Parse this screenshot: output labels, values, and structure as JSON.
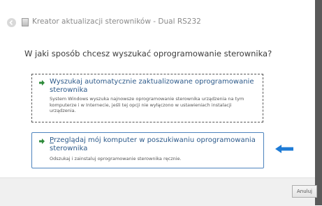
{
  "window": {
    "title": "Kreator aktualizacji sterowników - Dual RS232"
  },
  "dialog": {
    "question": "W jaki sposób chcesz wyszukać oprogramowanie sterownika?",
    "option_auto": {
      "title_line1": "Wyszukaj automatycznie zaktualizowane oprogramowanie",
      "title_line2": "sterownika",
      "description": "System Windows wyszuka najnowsze oprogramowanie sterownika urządzenia na tym komputerze i w Internecie, jeśli tej opcji nie wyłączono w ustawieniach instalacji urządzenia."
    },
    "option_browse": {
      "title_underlined": "P",
      "title_rest": "rzeglądaj mój komputer w poszukiwaniu oprogramowania",
      "title_line2": "sterownika",
      "description": "Odszukaj i zainstaluj oprogramowanie sterownika ręcznie."
    }
  },
  "footer": {
    "cancel_label": "Anuluj"
  },
  "colors": {
    "link": "#2d5a8a",
    "selected_border": "#4d83bd",
    "pointer_arrow": "#1e7bd6",
    "option_arrow": "#2e8b3a"
  }
}
